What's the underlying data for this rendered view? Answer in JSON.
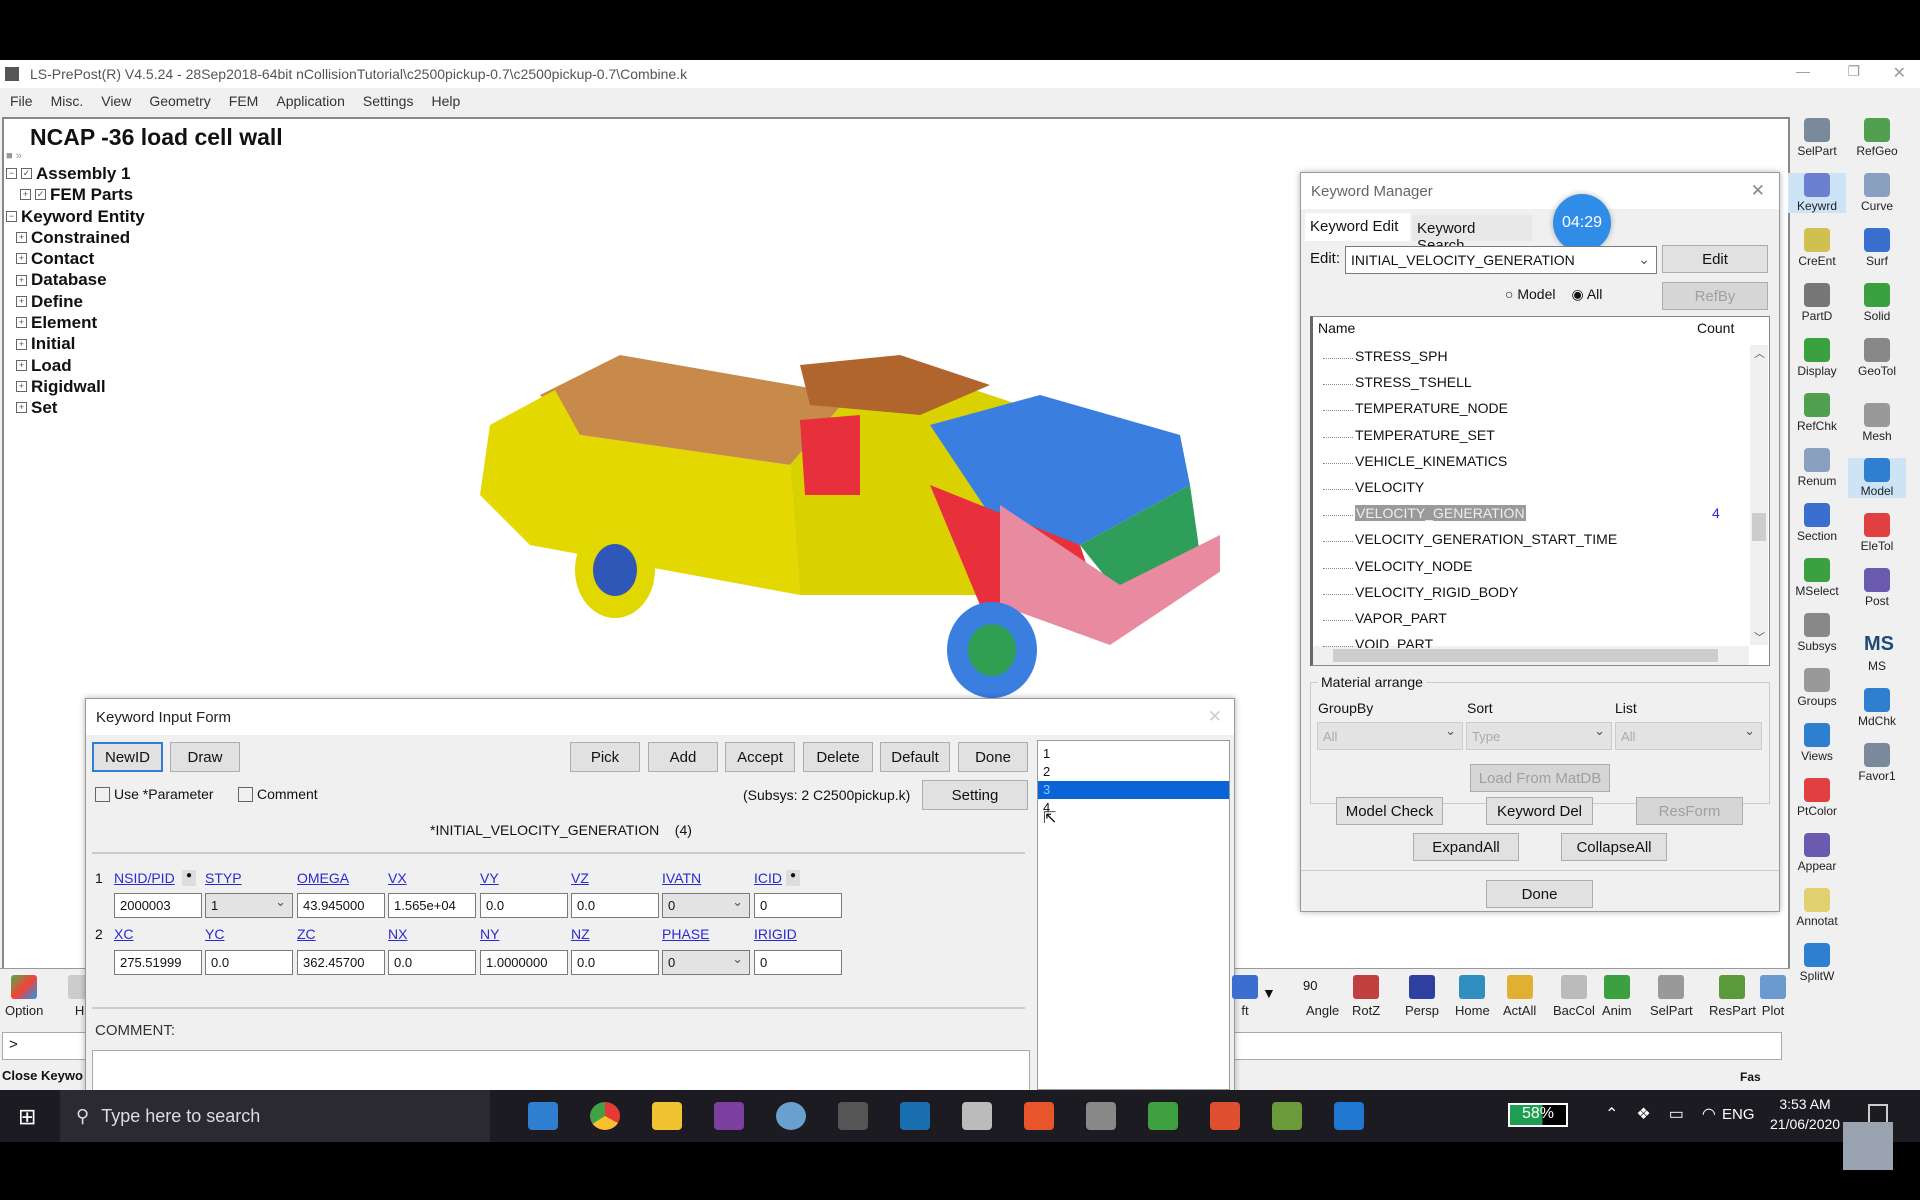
{
  "window": {
    "title": "LS-PrePost(R) V4.5.24 - 28Sep2018-64bit nCollisionTutorial\\c2500pickup-0.7\\c2500pickup-0.7\\Combine.k"
  },
  "menu": [
    "File",
    "Misc.",
    "View",
    "Geometry",
    "FEM",
    "Application",
    "Settings",
    "Help"
  ],
  "viewport": {
    "title": "NCAP -36 load cell wall"
  },
  "tree": {
    "assembly": "Assembly 1",
    "fem_parts": "FEM Parts",
    "keyword_entity": "Keyword Entity",
    "items": [
      "Constrained",
      "Contact",
      "Database",
      "Define",
      "Element",
      "Initial",
      "Load",
      "Rigidwall",
      "Set"
    ]
  },
  "keyword_manager": {
    "title": "Keyword Manager",
    "tabs": [
      "Keyword Edit",
      "Keyword Search"
    ],
    "timer": "04:29",
    "edit_label": "Edit:",
    "edit_value": "INITIAL_VELOCITY_GENERATION",
    "edit_button": "Edit",
    "radio_model": "Model",
    "radio_all": "All",
    "radio_selected": "All",
    "refby_button": "RefBy",
    "col_name": "Name",
    "col_count": "Count",
    "rows": [
      {
        "name": "STRESS_SPH",
        "count": ""
      },
      {
        "name": "STRESS_TSHELL",
        "count": ""
      },
      {
        "name": "TEMPERATURE_NODE",
        "count": ""
      },
      {
        "name": "TEMPERATURE_SET",
        "count": ""
      },
      {
        "name": "VEHICLE_KINEMATICS",
        "count": ""
      },
      {
        "name": "VELOCITY",
        "count": ""
      },
      {
        "name": "VELOCITY_GENERATION",
        "count": "4"
      },
      {
        "name": "VELOCITY_GENERATION_START_TIME",
        "count": ""
      },
      {
        "name": "VELOCITY_NODE",
        "count": ""
      },
      {
        "name": "VELOCITY_RIGID_BODY",
        "count": ""
      },
      {
        "name": "VAPOR_PART",
        "count": ""
      },
      {
        "name": "VOID_PART",
        "count": ""
      }
    ],
    "selected_row": "VELOCITY_GENERATION",
    "material_group": "Material arrange",
    "groupby_label": "GroupBy",
    "groupby_value": "All",
    "sort_label": "Sort",
    "sort_value": "Type",
    "list_label": "List",
    "list_value": "All",
    "load_matdb": "Load From MatDB",
    "model_check": "Model Check",
    "keyword_del": "Keyword Del",
    "resform": "ResForm",
    "expand_all": "ExpandAll",
    "collapse_all": "CollapseAll",
    "done": "Done"
  },
  "input_form": {
    "title": "Keyword Input Form",
    "buttons": {
      "newid": "NewID",
      "draw": "Draw",
      "pick": "Pick",
      "add": "Add",
      "accept": "Accept",
      "delete": "Delete",
      "default": "Default",
      "done": "Done",
      "setting": "Setting"
    },
    "use_parameter": "Use *Parameter",
    "comment_check": "Comment",
    "subsys": "(Subsys: 2 C2500pickup.k)",
    "keyword_title": "*INITIAL_VELOCITY_GENERATION    (4)",
    "id_list": [
      "1",
      "2",
      "3",
      "4"
    ],
    "id_selected": "3",
    "card1": {
      "num": "1",
      "fields": [
        {
          "label": "NSID/PID",
          "value": "2000003"
        },
        {
          "label": "STYP",
          "value": "1",
          "select": true
        },
        {
          "label": "OMEGA",
          "value": "43.945000"
        },
        {
          "label": "VX",
          "value": "1.565e+04"
        },
        {
          "label": "VY",
          "value": "0.0"
        },
        {
          "label": "VZ",
          "value": "0.0"
        },
        {
          "label": "IVATN",
          "value": "0",
          "select": true
        },
        {
          "label": "ICID",
          "value": "0"
        }
      ]
    },
    "card2": {
      "num": "2",
      "fields": [
        {
          "label": "XC",
          "value": "275.51999"
        },
        {
          "label": "YC",
          "value": "0.0"
        },
        {
          "label": "ZC",
          "value": "362.45700"
        },
        {
          "label": "NX",
          "value": "0.0"
        },
        {
          "label": "NY",
          "value": "1.0000000"
        },
        {
          "label": "NZ",
          "value": "0.0"
        },
        {
          "label": "PHASE",
          "value": "0",
          "select": true
        },
        {
          "label": "IRIGID",
          "value": "0"
        }
      ]
    },
    "comment_label": "COMMENT:"
  },
  "right_toolbar": {
    "col1": [
      "SelPart",
      "Keywrd",
      "CreEnt",
      "PartD",
      "Display",
      "RefChk",
      "Renum",
      "Section",
      "MSelect",
      "Subsys",
      "Groups",
      "Views",
      "PtColor",
      "Appear",
      "Annotat",
      "SplitW"
    ],
    "col2": [
      "RefGeo",
      "Curve",
      "Surf",
      "Solid",
      "GeoTol",
      "Mesh",
      "Model",
      "EleTol",
      "Post",
      "MS",
      "MdChk",
      "Favor1"
    ],
    "active": [
      "Keywrd",
      "Model"
    ]
  },
  "bottom_toolbar": {
    "left": [
      "Option",
      "Hi"
    ],
    "right": [
      "ft",
      "Angle",
      "RotZ",
      "Persp",
      "Home",
      "ActAll",
      "BacCol",
      "Anim",
      "SelPart",
      "ResPart",
      "Plot"
    ],
    "angle_value": "90"
  },
  "command_prompt": ">",
  "status_text": "Close Keywo",
  "status_right": "Fas",
  "taskbar": {
    "search_placeholder": "Type here to search",
    "battery": "58%",
    "language": "ENG",
    "time": "3:53 AM",
    "date": "21/06/2020"
  },
  "colors": {
    "selection": "#0a64d8",
    "accent_active": "#cde4f7",
    "link": "#2a2ad0",
    "truck_yellow": "#e3d800",
    "truck_red": "#e8303c",
    "truck_blue": "#3a7fe0"
  }
}
